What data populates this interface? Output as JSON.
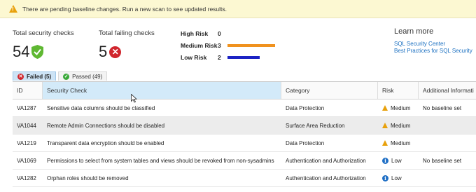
{
  "banner": {
    "message": "There are pending baseline changes. Run a new scan to see updated results."
  },
  "metrics": {
    "total": {
      "label": "Total security checks",
      "value": "54"
    },
    "failing": {
      "label": "Total failing checks",
      "value": "5"
    }
  },
  "risk_summary": [
    {
      "name": "High Risk",
      "count": "0",
      "fraction": 0,
      "color": "#e8900f"
    },
    {
      "name": "Medium Risk",
      "count": "3",
      "fraction": 1.0,
      "color": "#f0921e"
    },
    {
      "name": "Low Risk",
      "count": "2",
      "fraction": 0.67,
      "color": "#1c23c4"
    }
  ],
  "learn_more": {
    "title": "Learn more",
    "links": [
      "SQL Security Center",
      "Best Practices for SQL Security"
    ]
  },
  "tabs": [
    {
      "label": "Failed",
      "count": "(5)",
      "active": true
    },
    {
      "label": "Passed",
      "count": "(49)",
      "active": false
    }
  ],
  "table": {
    "columns": [
      "ID",
      "Security Check",
      "Category",
      "Risk",
      "Additional Informati"
    ],
    "rows": [
      {
        "id": "VA1287",
        "check": "Sensitive data columns should be classified",
        "category": "Data Protection",
        "risk": "Medium",
        "info": "No baseline set"
      },
      {
        "id": "VA1044",
        "check": "Remote Admin Connections should be disabled",
        "category": "Surface Area Reduction",
        "risk": "Medium",
        "info": ""
      },
      {
        "id": "VA1219",
        "check": "Transparent data encryption should be enabled",
        "category": "Data Protection",
        "risk": "Medium",
        "info": ""
      },
      {
        "id": "VA1069",
        "check": "Permissions to select from system tables and views should be revoked from non-sysadmins",
        "category": "Authentication and Authorization",
        "risk": "Low",
        "info": "No baseline set"
      },
      {
        "id": "VA1282",
        "check": "Orphan roles should be removed",
        "category": "Authentication and Authorization",
        "risk": "Low",
        "info": ""
      }
    ]
  }
}
